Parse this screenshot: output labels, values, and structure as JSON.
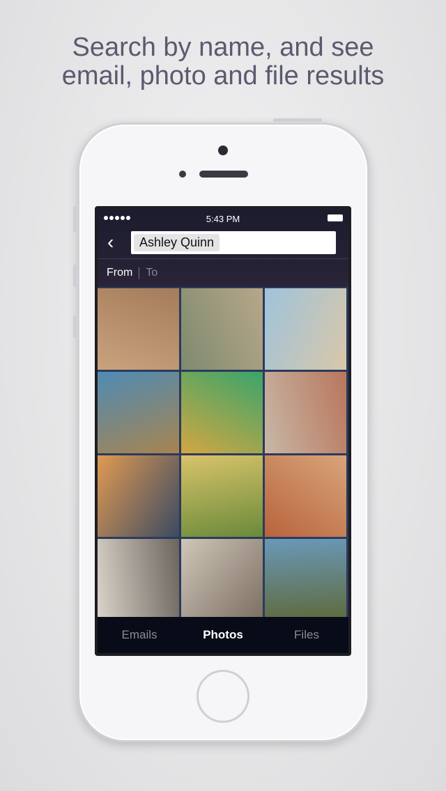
{
  "headline": {
    "line1": "Search by name, and see",
    "line2": "email, photo and file results"
  },
  "status_bar": {
    "time": "5:43 PM",
    "signal_dots": 5
  },
  "search": {
    "back_icon": "chevron-left-icon",
    "token": "Ashley Quinn"
  },
  "filters": {
    "from": "From",
    "to": "To",
    "selected": "From"
  },
  "photos": [
    {
      "colors": [
        "#c9a27e",
        "#a57c5b"
      ]
    },
    {
      "colors": [
        "#7e8a6e",
        "#b7a78a"
      ]
    },
    {
      "colors": [
        "#9fc3dc",
        "#d9c7a8"
      ]
    },
    {
      "colors": [
        "#4f8bb5",
        "#a7844f"
      ]
    },
    {
      "colors": [
        "#d3a642",
        "#3aa56a"
      ]
    },
    {
      "colors": [
        "#c7b7a6",
        "#b9765c"
      ]
    },
    {
      "colors": [
        "#e09a52",
        "#3c4a62"
      ]
    },
    {
      "colors": [
        "#d8c36a",
        "#6a8a3a"
      ]
    },
    {
      "colors": [
        "#b8643c",
        "#d8a47a"
      ]
    },
    {
      "colors": [
        "#d9d3c9",
        "#6b655e"
      ]
    },
    {
      "colors": [
        "#cfc6b8",
        "#7c6f63"
      ]
    },
    {
      "colors": [
        "#6a98b8",
        "#5e6a3c"
      ]
    }
  ],
  "tabs": [
    {
      "label": "Emails",
      "active": false
    },
    {
      "label": "Photos",
      "active": true
    },
    {
      "label": "Files",
      "active": false
    }
  ]
}
